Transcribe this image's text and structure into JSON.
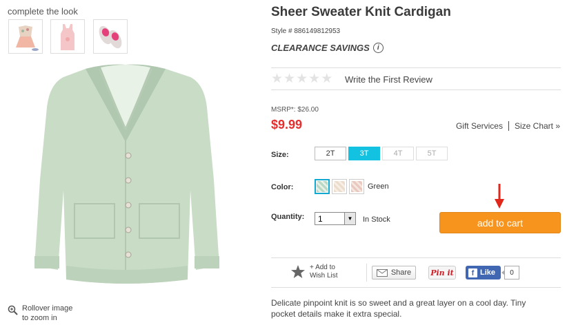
{
  "complete_look": {
    "title": "complete the look",
    "thumbnails": [
      {
        "name": "dress-outfit"
      },
      {
        "name": "pink-tank-top"
      },
      {
        "name": "pink-shoes"
      }
    ]
  },
  "zoom_hint": {
    "line1": "Rollover image",
    "line2": "to zoom in"
  },
  "product": {
    "title": "Sheer Sweater Knit Cardigan",
    "style": "Style # 886149812953",
    "clearance": "CLEARANCE SAVINGS",
    "info_icon": "i",
    "review_link": "Write the First Review",
    "rating_stars": 5,
    "msrp": "MSRP*: $26.00",
    "price": "$9.99",
    "gift_services": "Gift Services",
    "size_chart": "Size Chart »"
  },
  "size": {
    "label": "Size:",
    "options": [
      {
        "label": "2T",
        "state": "available"
      },
      {
        "label": "3T",
        "state": "selected"
      },
      {
        "label": "4T",
        "state": "unavailable"
      },
      {
        "label": "5T",
        "state": "unavailable"
      }
    ]
  },
  "color": {
    "label": "Color:",
    "selected_name": "Green",
    "swatches": [
      {
        "color": "#b9d8c4",
        "state": "selected"
      },
      {
        "color": "#ecdccb",
        "state": "available"
      },
      {
        "color": "#e9c9bf",
        "state": "available"
      }
    ]
  },
  "quantity": {
    "label": "Quantity:",
    "value": "1",
    "stock": "In Stock"
  },
  "cart": {
    "label": "add to cart"
  },
  "social": {
    "wishlist_line1": "+ Add to",
    "wishlist_line2": "Wish List",
    "share": "Share",
    "pinit": "Pin it",
    "fb_like": "Like",
    "fb_count": "0"
  },
  "description": "Delicate pinpoint knit is so sweet and a great layer on a cool day. Tiny pocket details make it extra special.",
  "colors": {
    "price_red": "#e52e2e",
    "size_selected": "#12c2e0",
    "cart_orange": "#f7941d",
    "facebook_blue": "#4267b2",
    "pinterest_red": "#cb2027"
  }
}
